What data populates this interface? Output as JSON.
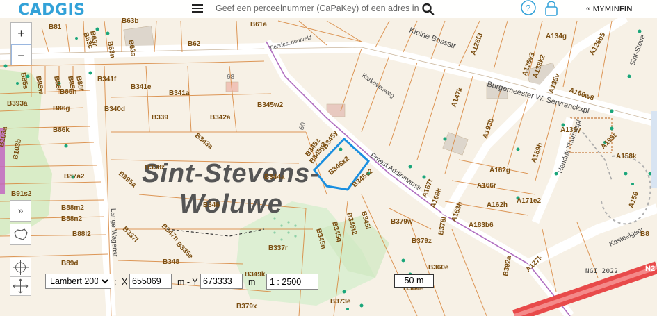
{
  "header": {
    "logo_text": "CADGIS",
    "search_placeholder": "Geef een perceelnummer (CaPaKey) of een adres in",
    "help_icon": "help-icon",
    "lock_icon": "lock-icon",
    "mymin_prefix": "« MYMIN",
    "mymin_suffix": "FIN"
  },
  "controls": {
    "zoom_in": "+",
    "zoom_out": "−",
    "expand": "»",
    "crs_options": [
      "Lambert 2008"
    ],
    "crs_selected": "Lambert 2008",
    "colon": ":",
    "x_label": "X",
    "x_value": "655069",
    "separator": "m - Y",
    "y_value": "673333",
    "unit": "m",
    "scale_value": "1 : 2500",
    "scalebar_label": "50 m"
  },
  "map": {
    "town_line1": "Sint-Stevens-",
    "town_line2": "Woluwe",
    "attribution": "NGI 2022",
    "road_number": "N2",
    "streets": [
      "Kleine Bossstr",
      "Burgemeester W. Servranckxpl",
      "Karkovenweg",
      "Ernest Addinmanstr",
      "Hendrik Thumaspl",
      "Lange Wagenst",
      "Tiendeschuurveld",
      "Kasteelgeer",
      "Sint-Steve"
    ],
    "elevations": [
      "68",
      "60"
    ],
    "parcels": [
      "B81",
      "B63c",
      "B63b",
      "B61a",
      "B62",
      "B63n",
      "B63s",
      "B63r",
      "B341f",
      "B341e",
      "B341a",
      "B340d",
      "B339",
      "B342a",
      "B345w2",
      "B393a",
      "B86g",
      "B86k",
      "B85s",
      "B85w",
      "B85n",
      "B86r",
      "B85r",
      "B85f",
      "B103a",
      "B103b",
      "B87a2",
      "B91s2",
      "B88m2",
      "B88n2",
      "B88l2",
      "B89d",
      "B395a",
      "B338z",
      "B343a",
      "B344a",
      "B346",
      "B345z",
      "B345y2",
      "B345x2",
      "B345y",
      "B345s2",
      "B345t2",
      "B345l",
      "B345q",
      "B345n",
      "B337r",
      "B337l",
      "B347n",
      "B335e",
      "B348",
      "B349k",
      "B379x",
      "B379w",
      "B379z",
      "B378l",
      "B360e",
      "B373e",
      "B384e",
      "B392a",
      "A127k",
      "A134g",
      "A126b5",
      "A126f3",
      "A126v3",
      "A138k2",
      "A135v",
      "A166w8",
      "A147k",
      "A139y",
      "A193b",
      "A195t",
      "A158k",
      "A159h",
      "A162g",
      "A166r",
      "A167t",
      "A168k",
      "A163h",
      "A162h",
      "A171e2",
      "A183b6",
      "A156",
      "B8"
    ]
  }
}
